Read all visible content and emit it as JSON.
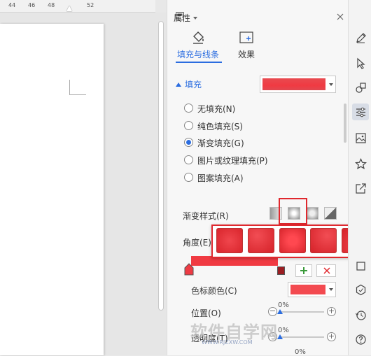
{
  "ruler": {
    "ticks": [
      "44",
      "46",
      "48",
      "52"
    ]
  },
  "panel": {
    "title": "属性",
    "tabs": [
      {
        "label": "填充与线条"
      },
      {
        "label": "效果"
      }
    ],
    "fill_section": "填充",
    "fill_options": [
      {
        "label": "无填充(N)",
        "selected": false
      },
      {
        "label": "纯色填充(S)",
        "selected": false
      },
      {
        "label": "渐变填充(G)",
        "selected": true
      },
      {
        "label": "图片或纹理填充(P)",
        "selected": false
      },
      {
        "label": "图案填充(A)",
        "selected": false
      }
    ],
    "gradient_style_label": "渐变样式(R)",
    "angle_label": "角度(E)",
    "stop_color_label": "色标颜色(C)",
    "position_label": "位置(O)",
    "position_value": "0%",
    "transparency_label": "透明度(T)",
    "transparency_value": "0%",
    "brightness_value": "0%"
  },
  "watermark": {
    "line1": "软件自学网",
    "line2": "WWW.RJZXW.COM"
  },
  "colors": {
    "fill_red": "#ee3b44",
    "highlight_border": "#e0282e",
    "radio_on": "#2b6de0"
  },
  "right_toolbar": [
    "pen-icon",
    "cursor-icon",
    "shapes-icon",
    "settings-sliders-icon",
    "image-edit-icon",
    "star-icon",
    "share-icon",
    "block-icon",
    "hexagon-icon",
    "history-icon",
    "help-icon"
  ]
}
